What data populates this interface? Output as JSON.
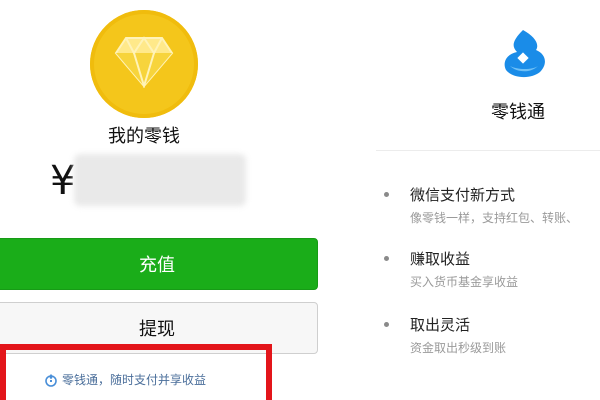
{
  "wallet": {
    "title": "我的零钱",
    "currency_symbol": "¥",
    "balance_hidden": true,
    "recharge_label": "充值",
    "withdraw_label": "提现",
    "promo_text": "零钱通，随时支付并享收益",
    "colors": {
      "coin": "#f4c61b",
      "primary_button": "#1aad19",
      "highlight_border": "#e3151a",
      "promo_text": "#4a6e9a"
    },
    "icons": {
      "coin": "diamond-icon",
      "promo": "lingqiantong-icon"
    }
  },
  "lingqiantong": {
    "title": "零钱通",
    "logo_icon": "lingqiantong-logo-icon",
    "features": [
      {
        "title": "微信支付新方式",
        "description": "像零钱一样，支持红包、转账、"
      },
      {
        "title": "赚取收益",
        "description": "买入货币基金享收益"
      },
      {
        "title": "取出灵活",
        "description": "资金取出秒级到账"
      }
    ],
    "colors": {
      "logo_primary": "#1a8ce8"
    }
  }
}
